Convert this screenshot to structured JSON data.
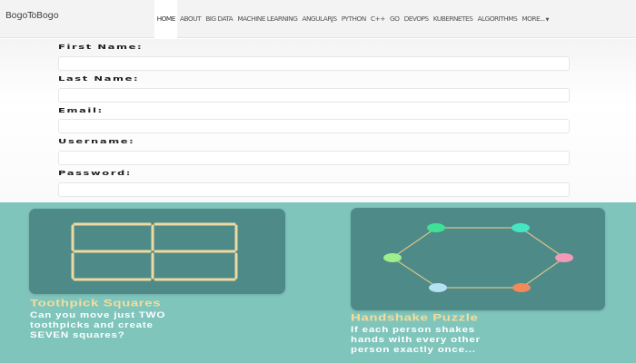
{
  "brand": "BogoToBogo",
  "nav": {
    "items": [
      "HOME",
      "ABOUT",
      "BIG DATA",
      "MACHINE LEARNING",
      "ANGULARJS",
      "PYTHON",
      "C++",
      "GO",
      "DEVOPS",
      "KUBERNETES",
      "ALGORITHMS",
      "MORE..."
    ],
    "active": "HOME"
  },
  "form": {
    "first_name_label": "First Name:",
    "last_name_label": "Last Name:",
    "email_label": "Email:",
    "username_label": "Username:",
    "password_label": "Password:"
  },
  "puzzles": {
    "toothpick": {
      "title": "Toothpick Squares",
      "text": [
        "Can you move just TWO",
        "toothpicks and create",
        "SEVEN squares?"
      ]
    },
    "handshake": {
      "title": "Handshake Puzzle",
      "text": [
        "If each person shakes",
        "hands with every other",
        "person exactly once..."
      ]
    }
  },
  "colors": {
    "banner_bg": "#80c5bc",
    "card_bg": "#4e8b88",
    "title_gold": "#f3dd9a",
    "toothpick": "#eed9a0",
    "node_colors": [
      "#3ee296",
      "#46e6c4",
      "#f49ab6",
      "#f08a5a",
      "#b7e0f2",
      "#9cef8c"
    ]
  }
}
